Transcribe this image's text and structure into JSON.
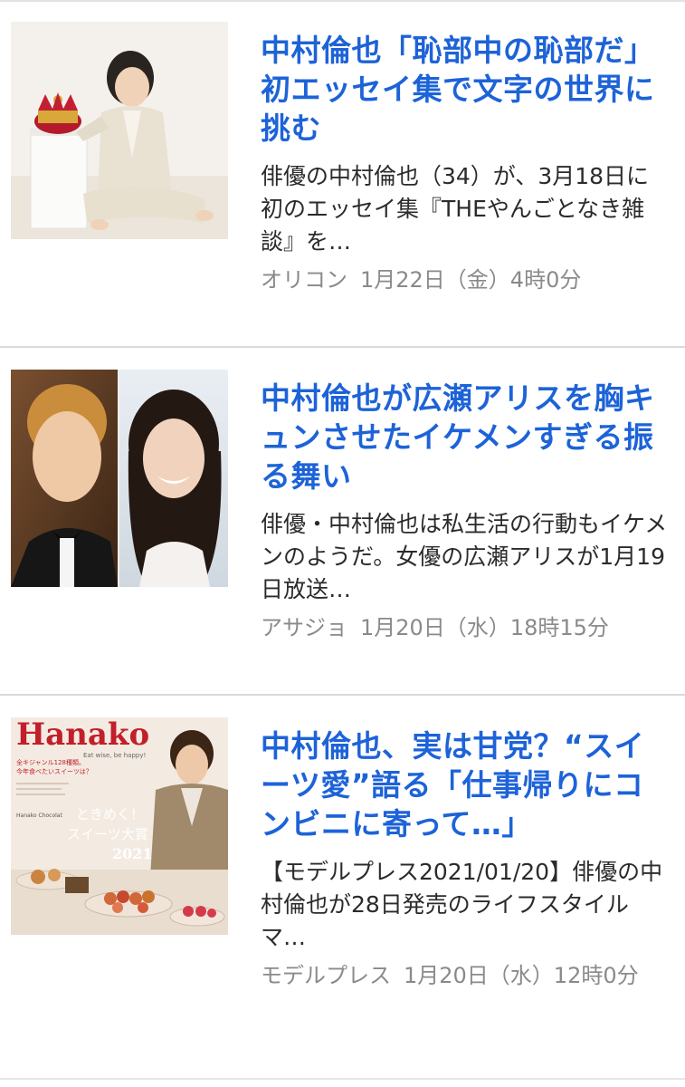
{
  "articles": [
    {
      "headline": "中村倫也「恥部中の恥部だ」　初エッセイ集で文字の世界に挑む",
      "summary": "俳優の中村倫也（34）が、3月18日に初のエッセイ集『THEやんごとなき雑談』を…",
      "source": "オリコン",
      "date": "1月22日（金）4時0分",
      "thumbnail_icon": "photo-man-with-crown"
    },
    {
      "headline": "中村倫也が広瀬アリスを胸キュンさせたイケメンすぎる振る舞い",
      "summary": "俳優・中村倫也は私生活の行動もイケメンのようだ。女優の広瀬アリスが1月19日放送…",
      "source": "アサジョ",
      "date": "1月20日（水）18時15分",
      "thumbnail_icon": "photo-two-portraits"
    },
    {
      "headline": "中村倫也、実は甘党？“スイーツ愛”語る「仕事帰りにコンビニに寄って…」",
      "summary": "【モデルプレス2021/01/20】俳優の中村倫也が28日発売のライフスタイルマ…",
      "source": "モデルプレス",
      "date": "1月20日（水）12時0分",
      "thumbnail_icon": "photo-magazine-cover",
      "thumbnail_text": {
        "masthead": "Hanako",
        "tagline": "Eat wise, be happy!",
        "cover_line_1": "ときめく！",
        "cover_line_2": "スイーツ大賞",
        "year": "2021",
        "side_copy_1": "全キジャンル128種類。",
        "side_copy_2": "今年食べたいスイーツは？",
        "box_label": "Hanako Chocolat"
      }
    }
  ],
  "colors": {
    "headline": "#1d63d8",
    "summary": "#2b2b2b",
    "meta": "#8a8a8a",
    "divider": "#d9d9d9"
  }
}
